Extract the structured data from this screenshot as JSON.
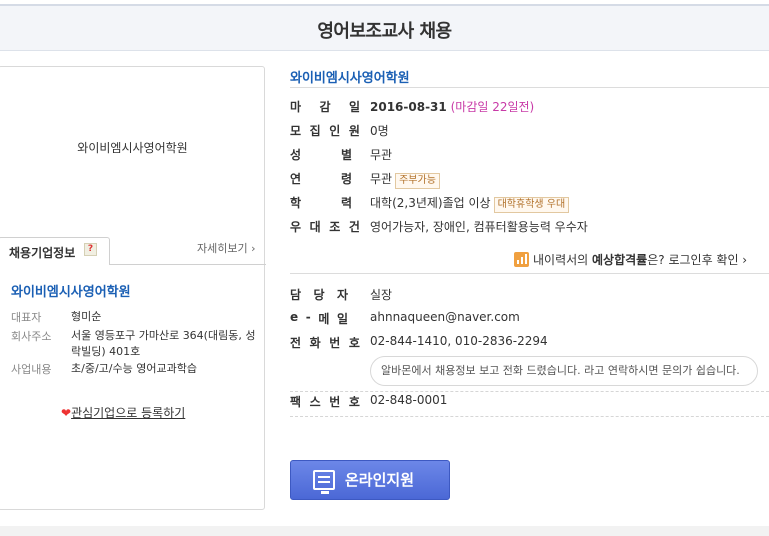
{
  "header": {
    "title": "영어보조교사 채용"
  },
  "company_box": {
    "logo_text": "와이비엠시사영어학원",
    "tab_label": "채용기업정보",
    "help": "?",
    "more_link": "자세히보기 ›",
    "name": "와이비엠시사영어학원",
    "rows": [
      {
        "label": "대표자",
        "value": "형미순"
      },
      {
        "label": "회사주소",
        "value": "서울 영등포구 가마산로 364(대림동, 성락빌딩) 401호"
      },
      {
        "label": "사업내용",
        "value": "초/중/고/수능 영어교과학습"
      }
    ],
    "favorite": {
      "heart": "❤",
      "label": "관심기업으로 등록하기"
    }
  },
  "job": {
    "company_name": "와이비엠시사영어학원",
    "deadline": {
      "label": [
        "마",
        "감",
        "일"
      ],
      "value": "2016-08-31",
      "dday": "(마감일 22일전)"
    },
    "recruits": {
      "label": [
        "모",
        "집",
        "인",
        "원"
      ],
      "value": "0명"
    },
    "gender": {
      "label": [
        "성",
        "별"
      ],
      "value": "무관"
    },
    "age": {
      "label": [
        "연",
        "령"
      ],
      "value": "무관",
      "tag": "주부가능"
    },
    "education": {
      "label": [
        "학",
        "력"
      ],
      "value": "대학(2,3년제)졸업 이상",
      "tag": "대학휴학생 우대"
    },
    "preference": {
      "label": [
        "우",
        "대",
        "조",
        "건"
      ],
      "value": "영어가능자, 장애인, 컴퓨터활용능력 우수자"
    },
    "expect": {
      "prefix": "내이력서의 ",
      "bold": "예상합격률",
      "suffix": "은? 로그인후 확인 ›"
    },
    "manager": {
      "label": [
        "담",
        "당",
        "자"
      ],
      "value": "실장"
    },
    "email": {
      "label": [
        "e",
        "-",
        "메",
        "일"
      ],
      "value": "ahnnaqueen@naver.com"
    },
    "phone": {
      "label": [
        "전",
        "화",
        "번",
        "호"
      ],
      "value": "02-844-1410, 010-2836-2294"
    },
    "phone_note": "알바몬에서 채용정보 보고 전화 드렸습니다. 라고 연락하시면 문의가 쉽습니다.",
    "fax": {
      "label": [
        "팩",
        "스",
        "번",
        "호"
      ],
      "value": "02-848-0001"
    },
    "apply_button": "온라인지원"
  }
}
